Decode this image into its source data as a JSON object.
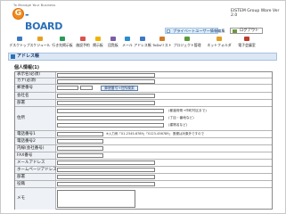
{
  "header": {
    "tagline": "To Manage Your Business",
    "logo_letter": "G",
    "logo_text": "-BOARD",
    "version": "EISTEM Group Ware Ver 2.0",
    "info_text": "プライベートユーザー情報編集",
    "logout_label": "ログアウト"
  },
  "nav": {
    "items": [
      {
        "label": "デスクトップ",
        "color": "#3d79c4"
      },
      {
        "label": "スケジュール",
        "color": "#e8a020"
      },
      {
        "label": "行き先掲示板",
        "color": "#2c9b5a"
      },
      {
        "label": "施設予約",
        "color": "#d9534f"
      },
      {
        "label": "掲示板",
        "color": "#f0b400"
      },
      {
        "label": "回覧板",
        "color": "#7b5ea7"
      },
      {
        "label": "メール",
        "color": "#2a8dd0"
      },
      {
        "label": "アドレス帳",
        "color": "#3d79c4"
      },
      {
        "label": "ToDoリスト",
        "color": "#d07a2a"
      },
      {
        "label": "プロジェクト管理",
        "color": "#5a9b3e"
      },
      {
        "label": "ネットフォルダ",
        "color": "#e0a020"
      },
      {
        "label": "電子会議室",
        "color": "#c0392b"
      }
    ]
  },
  "section": {
    "title": "アドレス帳"
  },
  "form": {
    "title": "個人情報(1)",
    "fields": {
      "name": "表示名(必須)",
      "kana": "カナ(必須)",
      "postal": "郵便番号",
      "company": "会社名",
      "department": "部署",
      "address": "住所",
      "phone1": "電話番号1",
      "phone2": "電話番号2",
      "extension": "内線(会社番号)",
      "fax": "FAX番号",
      "email": "メールアドレス",
      "homepage": "ホームページアドレス",
      "position": "部署",
      "title_field": "役職",
      "memo": "メモ"
    },
    "postal_button": "郵便番号→住所検索",
    "address_notes": [
      "(都道府県→市町村区まで)",
      "(丁目・番地など)",
      "(建物名など)"
    ],
    "phone_note": "※入力例「01-2345-6789」「0123-456789」 郵便は対象外ですので"
  }
}
